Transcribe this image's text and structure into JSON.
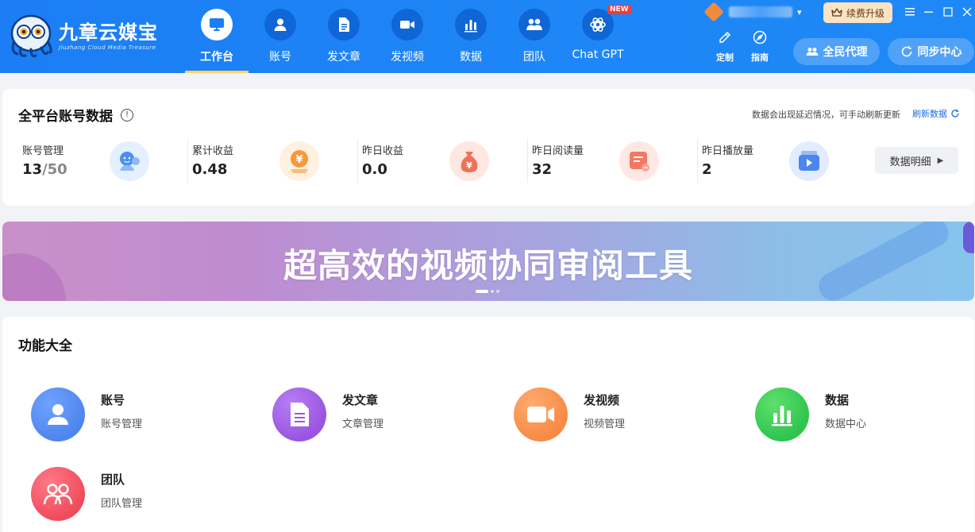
{
  "app": {
    "logo_title": "九章云媒宝",
    "logo_subtitle": "Jiuzhang Cloud Media Treasure"
  },
  "nav": [
    {
      "label": "工作台",
      "icon": "monitor-icon",
      "active": true
    },
    {
      "label": "账号",
      "icon": "user-icon"
    },
    {
      "label": "发文章",
      "icon": "document-icon"
    },
    {
      "label": "发视频",
      "icon": "video-camera-icon"
    },
    {
      "label": "数据",
      "icon": "bar-chart-icon"
    },
    {
      "label": "团队",
      "icon": "team-icon"
    },
    {
      "label": "Chat GPT",
      "icon": "openai-icon",
      "badge": "NEW"
    }
  ],
  "header": {
    "renew_label": "续费升级",
    "custom_label": "定制",
    "guide_label": "指南",
    "agent_label": "全民代理",
    "sync_label": "同步中心"
  },
  "stats": {
    "title": "全平台账号数据",
    "delay_note": "数据会出现延迟情况，可手动刷新更新",
    "refresh_label": "刷新数据",
    "detail_label": "数据明细",
    "items": [
      {
        "label": "账号管理",
        "value": "13",
        "total": "/50",
        "icon": "account-icon",
        "color": "#4a8ff0"
      },
      {
        "label": "累计收益",
        "value": "0.48",
        "icon": "coin-icon",
        "color": "#f59a3c"
      },
      {
        "label": "昨日收益",
        "value": "0.0",
        "icon": "money-bag-icon",
        "color": "#f07158"
      },
      {
        "label": "昨日阅读量",
        "value": "32",
        "icon": "read-icon",
        "color": "#f27862"
      },
      {
        "label": "昨日播放量",
        "value": "2",
        "icon": "play-icon",
        "color": "#4a86ee"
      }
    ]
  },
  "banner": {
    "text": "超高效的视频协同审阅工具"
  },
  "functions": {
    "title": "功能大全",
    "items": [
      {
        "name": "账号",
        "desc": "账号管理",
        "icon": "user-icon",
        "color": "#4f86ee"
      },
      {
        "name": "发文章",
        "desc": "文章管理",
        "icon": "document-icon",
        "color": "#9a55e0"
      },
      {
        "name": "发视频",
        "desc": "视频管理",
        "icon": "video-camera-icon",
        "color": "#f78a45"
      },
      {
        "name": "数据",
        "desc": "数据中心",
        "icon": "bar-chart-icon",
        "color": "#2fc44f"
      },
      {
        "name": "团队",
        "desc": "团队管理",
        "icon": "team-icon",
        "color": "#f04b5c"
      }
    ]
  }
}
